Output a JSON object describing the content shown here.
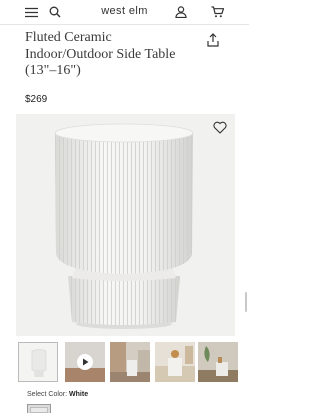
{
  "header": {
    "logo": "west elm",
    "menu_icon": "menu-icon",
    "search_icon": "search-icon",
    "account_icon": "user-icon",
    "cart_icon": "cart-icon"
  },
  "product": {
    "title_line1": "Fluted Ceramic",
    "title_line2": "Indoor/Outdoor Side Table",
    "title_line3": "(13\"–16\")",
    "price": "$269"
  },
  "gallery": {
    "thumbnails": [
      "side-table-white",
      "video",
      "room-scene-1",
      "room-scene-2",
      "room-scene-3"
    ],
    "selected_index": 0
  },
  "color": {
    "label": "Select Color:",
    "value": "White"
  },
  "colors": {
    "accent": "#222222",
    "hero_bg": "#f1f1f0"
  }
}
